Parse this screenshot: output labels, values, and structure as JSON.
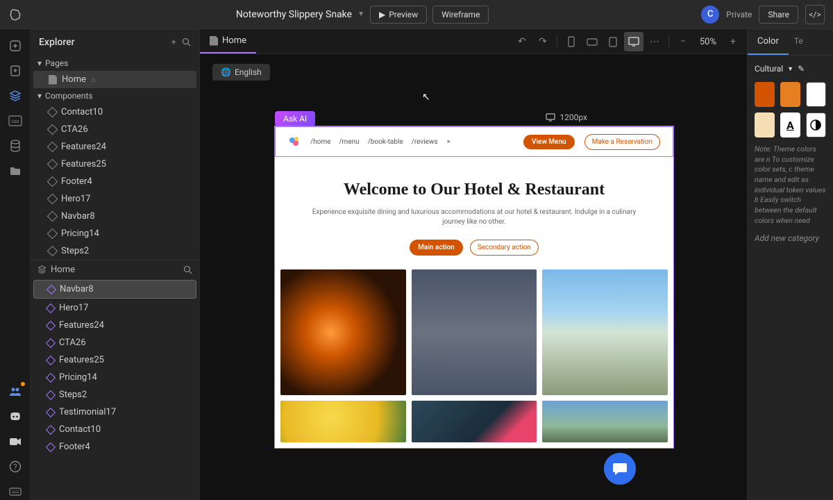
{
  "topbar": {
    "project_title": "Noteworthy Slippery Snake",
    "preview": "Preview",
    "wireframe": "Wireframe",
    "avatar_letter": "C",
    "private": "Private",
    "share": "Share"
  },
  "explorer": {
    "title": "Explorer",
    "pages_label": "Pages",
    "home_page": "Home",
    "components_label": "Components",
    "components": [
      "Contact10",
      "CTA26",
      "Features24",
      "Features25",
      "Footer4",
      "Hero17",
      "Navbar8",
      "Pricing14",
      "Steps2"
    ]
  },
  "outline": {
    "root": "Home",
    "items": [
      "Navbar8",
      "Hero17",
      "Features24",
      "CTA26",
      "Features25",
      "Pricing14",
      "Steps2",
      "Testimonial17",
      "Contact10",
      "Footer4"
    ],
    "selected": "Navbar8"
  },
  "canvas": {
    "tab": "Home",
    "language": "English",
    "ask_ai": "Ask AI",
    "viewport": "1200px",
    "zoom": "50%"
  },
  "preview": {
    "nav_links": [
      "/home",
      "/menu",
      "/book-table",
      "/reviews"
    ],
    "view_menu": "View Menu",
    "reserve": "Make a Reservation",
    "hero_title": "Welcome to Our Hotel & Restaurant",
    "hero_sub": "Experience exquisite dining and luxurious accommodations at our hotel & restaurant. Indulge in a culinary journey like no other.",
    "main_action": "Main action",
    "secondary_action": "Secondary action"
  },
  "right": {
    "tab1": "Color",
    "tab2": "Te",
    "theme": "Cultural",
    "colors": [
      "#d35400",
      "#e67e22",
      "#ffffff",
      "#f5deb3"
    ],
    "note": "Note: Theme colors are n To customize color sets, c theme name and edit as individual token values b Easily switch between the default colors when need",
    "add": "Add new category"
  }
}
